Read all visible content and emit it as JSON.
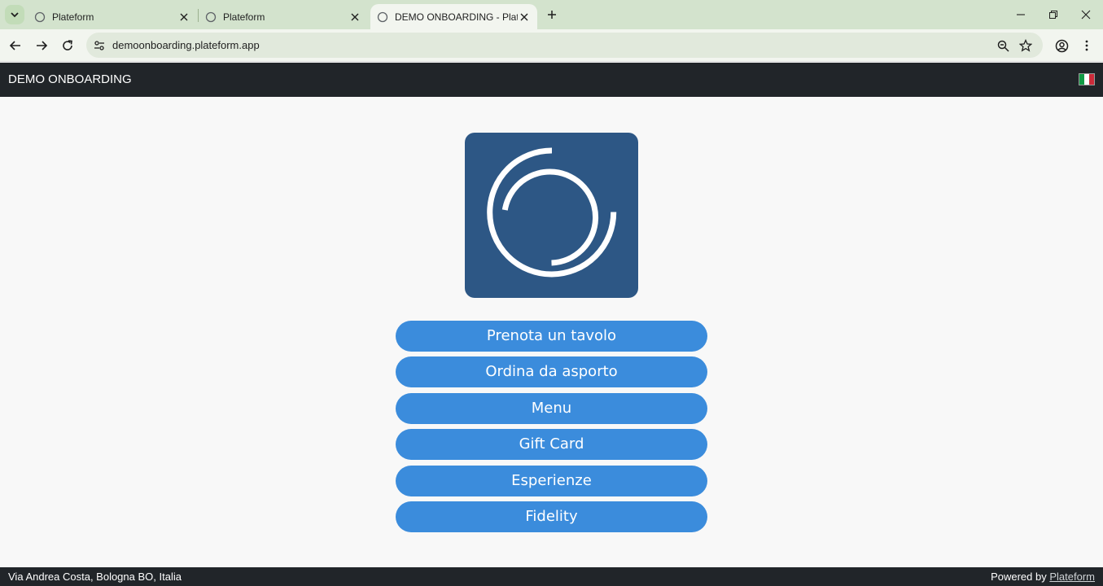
{
  "browser": {
    "tabs": [
      {
        "title": "Plateform",
        "active": false
      },
      {
        "title": "Plateform",
        "active": false
      },
      {
        "title": "DEMO ONBOARDING - Plateform",
        "active": true
      }
    ],
    "url": "demoonboarding.plateform.app"
  },
  "navbar": {
    "brand": "DEMO ONBOARDING",
    "language_flag": "italy-flag-icon"
  },
  "logo": {
    "icon": "plateform-logo-icon",
    "background": "#2d5785"
  },
  "actions": [
    {
      "label": "Prenota un tavolo"
    },
    {
      "label": "Ordina da asporto"
    },
    {
      "label": "Menu"
    },
    {
      "label": "Gift Card"
    },
    {
      "label": "Esperienze"
    },
    {
      "label": "Fidelity"
    }
  ],
  "footer": {
    "address": "Via Andrea Costa, Bologna BO, Italia",
    "powered_prefix": "Powered by",
    "powered_link": "Plateform"
  },
  "colors": {
    "accent": "#3b8cdc",
    "navbar": "#212529"
  }
}
